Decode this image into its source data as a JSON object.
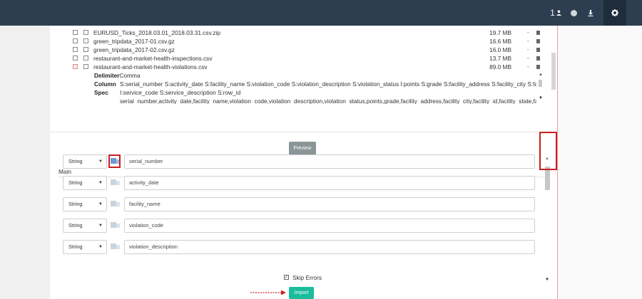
{
  "topbar": {
    "user_count": "1",
    "icons": [
      "user-icon",
      "status-dot-icon",
      "download-icon",
      "gear-icon"
    ]
  },
  "files": [
    {
      "name": "EURUSD_Ticks_2018.03.01_2018.03.31.csv.zip",
      "size": "19.7 MB",
      "dash": "-",
      "checked": false
    },
    {
      "name": "green_tripdata_2017-01.csv.gz",
      "size": "16.6 MB",
      "dash": "-",
      "checked": false
    },
    {
      "name": "green_tripdata_2017-02.csv.gz",
      "size": "16.0 MB",
      "dash": "-",
      "checked": false
    },
    {
      "name": "restaurant-and-market-health-inspections.csv",
      "size": "13.7 MB",
      "dash": "-",
      "checked": false
    },
    {
      "name": "restaurant-and-market-health-violations.csv",
      "size": "89.0 MB",
      "dash": "-",
      "checked": true
    }
  ],
  "delimiter": {
    "label": "Delimiter",
    "value": "Comma"
  },
  "column_spec": {
    "label_1": "Column",
    "label_2": "Spec",
    "lines": [
      "S:serial_number S:activity_date S:facility_name S:violation_code S:violation_description S:violation_status I:points S:grade S:facility_address S:facility_city S:facility_",
      "I:service_code S:service_description S:row_id",
      "serial_number,activity_date,facility_name,violation_code,violation_description,violation_status,points,grade,facility_address,facility_city,facility_id,facility_state,facil"
    ]
  },
  "preview_button": "Preview",
  "main_label": "Main",
  "columns": [
    {
      "type": "String",
      "name": "serial_number"
    },
    {
      "type": "String",
      "name": "activity_date"
    },
    {
      "type": "String",
      "name": "facility_name"
    },
    {
      "type": "String",
      "name": "violation_code"
    },
    {
      "type": "String",
      "name": "violation_description"
    }
  ],
  "skip_errors": {
    "label": "Skip Errors",
    "checked": true
  },
  "import_button": "Import",
  "colors": {
    "navbar": "#2d3e50",
    "import": "#1abc9c",
    "preview": "#8a9597",
    "highlight": "#cc1f1f"
  }
}
